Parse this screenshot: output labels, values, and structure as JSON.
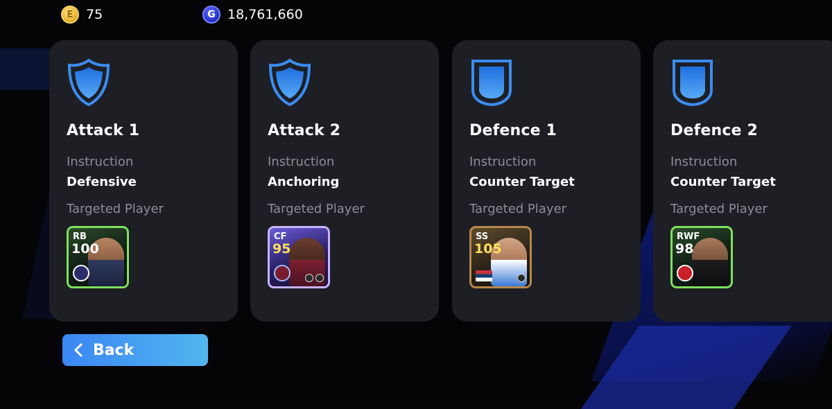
{
  "currency": {
    "coins": "75",
    "gp": "18,761,660",
    "coin_icon_glyph": "E",
    "gp_icon_glyph": "G"
  },
  "cards": [
    {
      "title": "Attack 1",
      "instruction_label": "Instruction",
      "instruction": "Defensive",
      "target_label": "Targeted Player",
      "player": {
        "position": "RB",
        "rating": "100",
        "frame": "green"
      }
    },
    {
      "title": "Attack 2",
      "instruction_label": "Instruction",
      "instruction": "Anchoring",
      "target_label": "Targeted Player",
      "player": {
        "position": "CF",
        "rating": "95",
        "frame": "purple"
      }
    },
    {
      "title": "Defence 1",
      "instruction_label": "Instruction",
      "instruction": "Counter Target",
      "target_label": "Targeted Player",
      "player": {
        "position": "SS",
        "rating": "105",
        "frame": "gold"
      }
    },
    {
      "title": "Defence 2",
      "instruction_label": "Instruction",
      "instruction": "Counter Target",
      "target_label": "Targeted Player",
      "player": {
        "position": "RWF",
        "rating": "98",
        "frame": "green"
      }
    }
  ],
  "back_button": {
    "label": "Back"
  },
  "colors": {
    "accent_blue": "#3b86f5",
    "card_bg": "#1e1f25",
    "muted_text": "#8e8f96"
  },
  "icons": {
    "attack": "attack-shield-icon",
    "defence": "defence-shield-icon",
    "back": "chevron-left-icon"
  }
}
